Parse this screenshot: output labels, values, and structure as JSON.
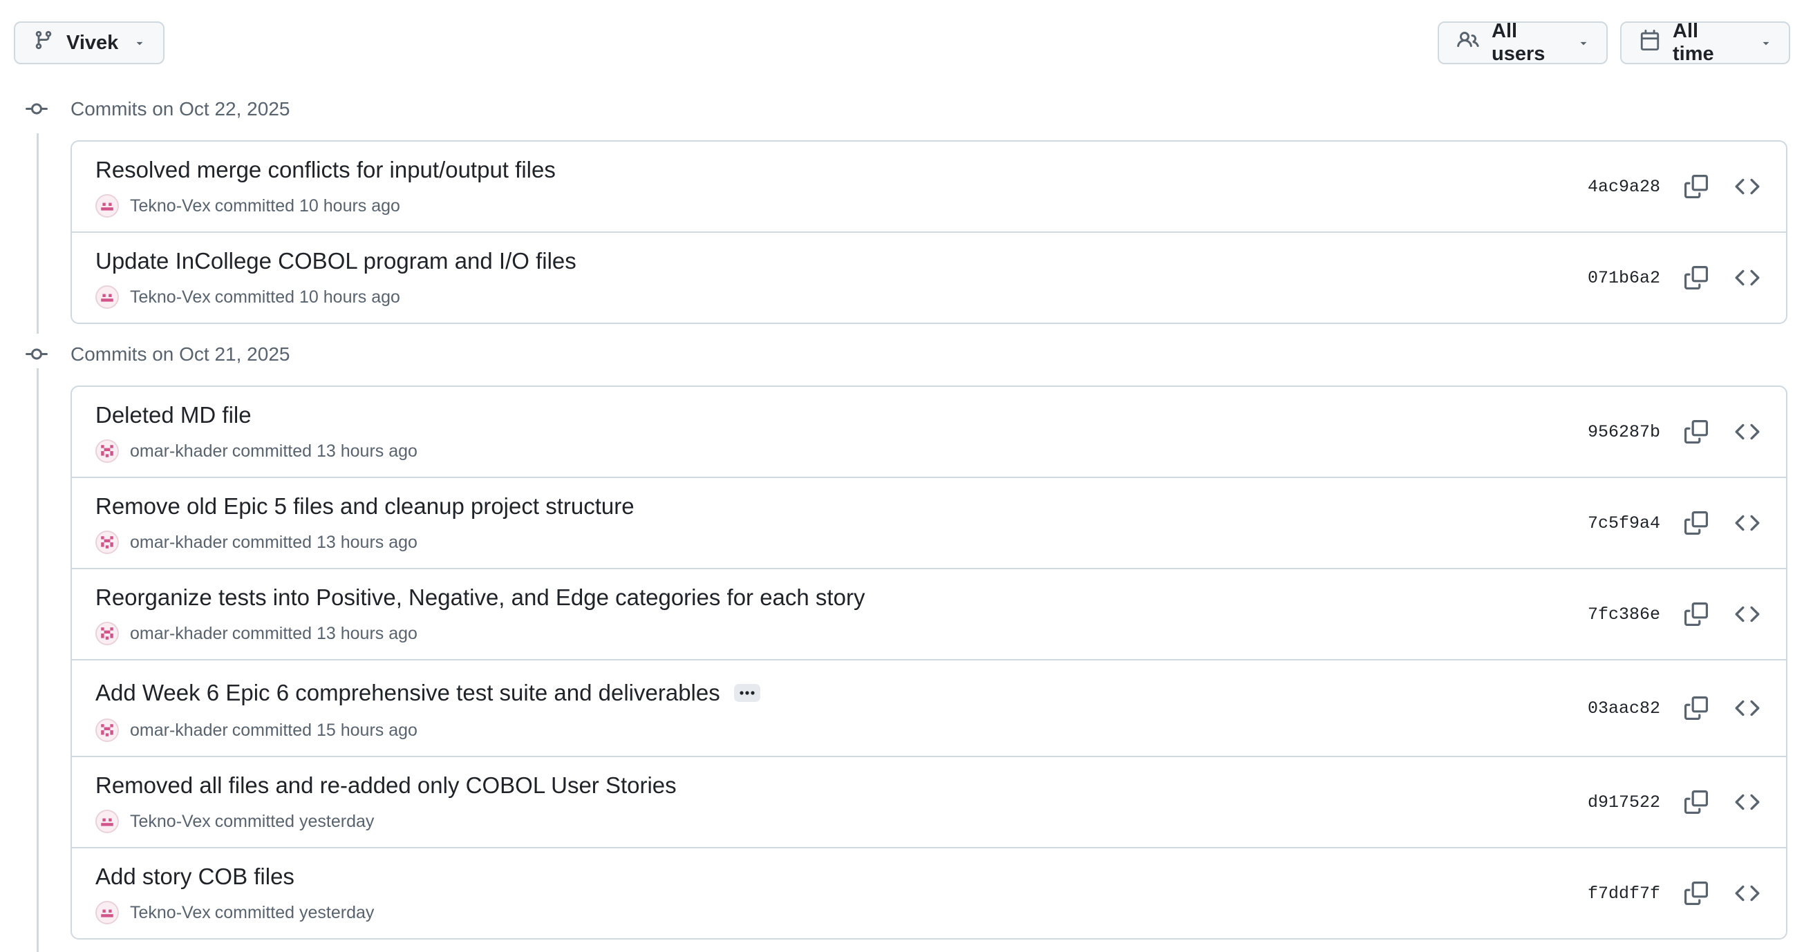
{
  "toolbar": {
    "branch_label": "Vivek",
    "users_label": "All users",
    "time_label": "All time"
  },
  "groups": [
    {
      "label": "Commits on Oct 22, 2025",
      "commits": [
        {
          "message": "Resolved merge conflicts for input/output files",
          "author": "Tekno-Vex",
          "time": "committed 10 hours ago",
          "sha": "4ac9a28"
        },
        {
          "message": "Update InCollege COBOL program and I/O files",
          "author": "Tekno-Vex",
          "time": "committed 10 hours ago",
          "sha": "071b6a2"
        }
      ]
    },
    {
      "label": "Commits on Oct 21, 2025",
      "commits": [
        {
          "message": "Deleted MD file",
          "author": "omar-khader",
          "time": "committed 13 hours ago",
          "sha": "956287b"
        },
        {
          "message": "Remove old Epic 5 files and cleanup project structure",
          "author": "omar-khader",
          "time": "committed 13 hours ago",
          "sha": "7c5f9a4"
        },
        {
          "message": "Reorganize tests into Positive, Negative, and Edge categories for each story",
          "author": "omar-khader",
          "time": "committed 13 hours ago",
          "sha": "7fc386e"
        },
        {
          "message": "Add Week 6 Epic 6 comprehensive test suite and deliverables",
          "author": "omar-khader",
          "time": "committed 15 hours ago",
          "sha": "03aac82"
        },
        {
          "message": "Removed all files and re-added only COBOL User Stories",
          "author": "Tekno-Vex",
          "time": "committed yesterday",
          "sha": "d917522"
        },
        {
          "message": "Add story COB files",
          "author": "Tekno-Vex",
          "time": "committed yesterday",
          "sha": "f7ddf7f"
        }
      ]
    }
  ],
  "icons": {
    "branch": "git-branch-icon",
    "users": "people-icon",
    "calendar": "calendar-icon",
    "commit": "git-commit-icon",
    "copy": "copy-icon",
    "browse": "code-icon",
    "ellipsis": "ellipsis-icon"
  },
  "colors": {
    "border": "#d1d9e0",
    "muted_text": "#59636e",
    "button_bg": "#f6f8fa",
    "avatar_pink": "#d2558a"
  }
}
